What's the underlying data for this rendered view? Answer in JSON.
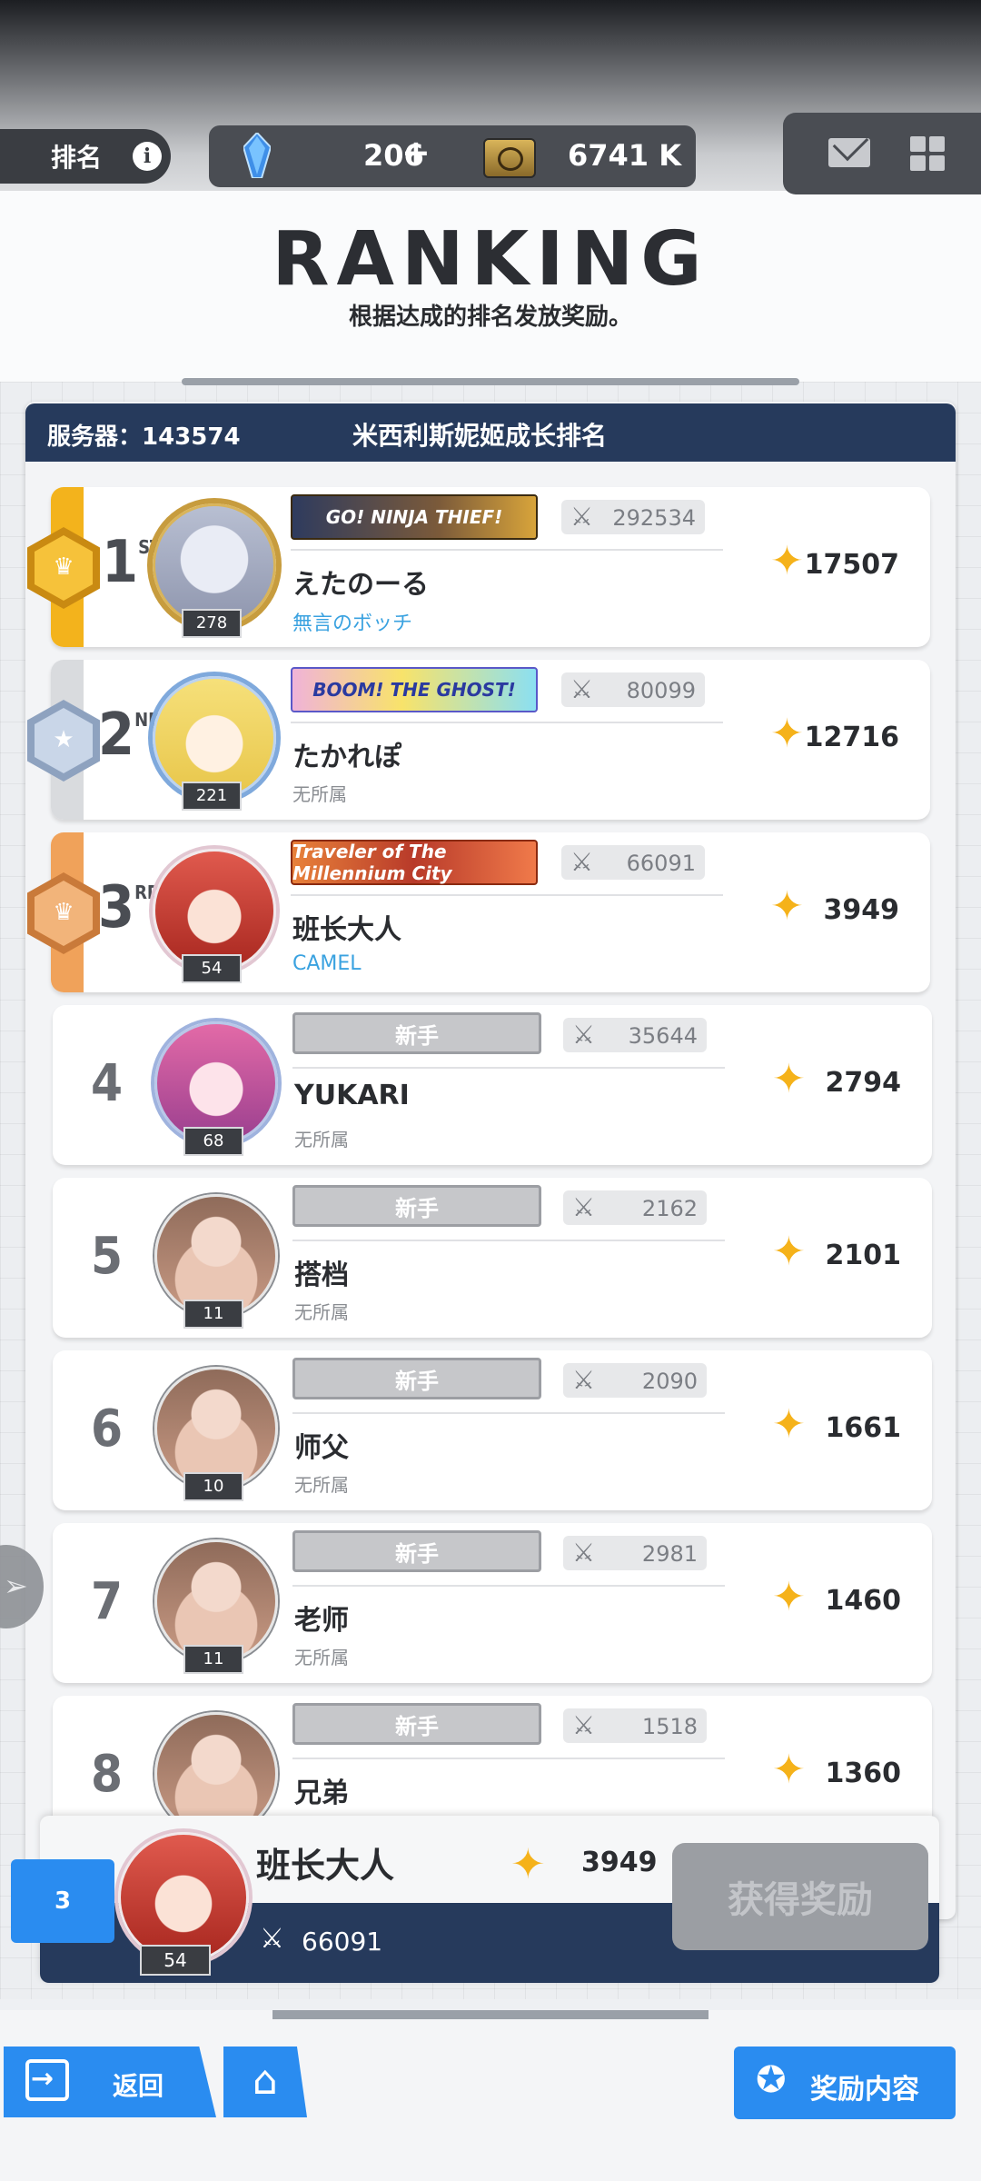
{
  "topbar": {
    "rank_label": "排名",
    "info_glyph": "i",
    "gems": "206",
    "gems_plus": "+",
    "credits": "6741 K",
    "icons": [
      "crystal-icon",
      "credit-icon",
      "mail-icon",
      "grid-menu-icon"
    ]
  },
  "header": {
    "title": "RANKING",
    "subtitle": "根据达成的排名发放奖励。"
  },
  "board": {
    "server": "服务器：143574",
    "name": "米西利斯妮姬成长排名"
  },
  "rows": [
    {
      "place": "1",
      "suffix": "ST",
      "name": "えたのーる",
      "guild": "無言のボッチ",
      "level": "278",
      "banner": "GO! NINJA THIEF!",
      "power": "292534",
      "score": "17507"
    },
    {
      "place": "2",
      "suffix": "ND",
      "name": "たかれぽ",
      "guild": "无所属",
      "level": "221",
      "banner": "BOOM! THE GHOST!",
      "power": "80099",
      "score": "12716"
    },
    {
      "place": "3",
      "suffix": "RD",
      "name": "班长大人",
      "guild": "CAMEL",
      "level": "54",
      "banner": "Traveler of The Millennium City",
      "power": "66091",
      "score": "3949"
    },
    {
      "place": "4",
      "name": "YUKARI",
      "guild": "无所属",
      "level": "68",
      "banner": "新手",
      "power": "35644",
      "score": "2794"
    },
    {
      "place": "5",
      "name": "搭档",
      "guild": "无所属",
      "level": "11",
      "banner": "新手",
      "power": "2162",
      "score": "2101"
    },
    {
      "place": "6",
      "name": "师父",
      "guild": "无所属",
      "level": "10",
      "banner": "新手",
      "power": "2090",
      "score": "1661"
    },
    {
      "place": "7",
      "name": "老师",
      "guild": "无所属",
      "level": "11",
      "banner": "新手",
      "power": "2981",
      "score": "1460"
    },
    {
      "place": "8",
      "name": "兄弟",
      "banner": "新手",
      "power": "1518",
      "score": "1360"
    }
  ],
  "my": {
    "rank": "3",
    "name": "班长大人",
    "score": "3949",
    "level": "54",
    "power": "66091",
    "claim": "获得奖励"
  },
  "bottom": {
    "back": "返回",
    "reward": "奖励内容"
  },
  "colors": {
    "accent": "#2a8cf0",
    "navy": "#263a5c",
    "gold": "#f3b31c",
    "silver": "#9fb0c8",
    "bronze": "#f0a25a",
    "star": "#f5b21a"
  }
}
